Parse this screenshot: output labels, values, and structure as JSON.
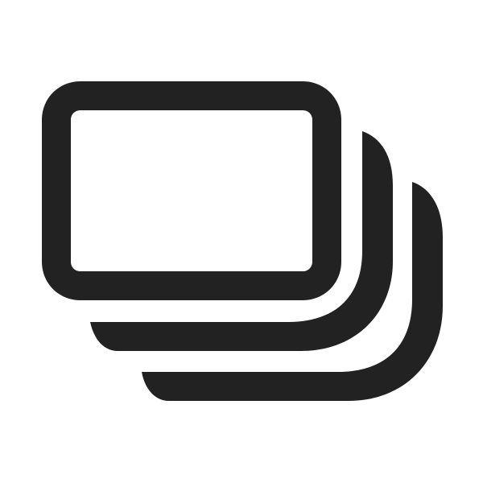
{
  "icon": {
    "name": "stacked-slides-icon",
    "color": "#222222",
    "background": "#ffffff"
  }
}
